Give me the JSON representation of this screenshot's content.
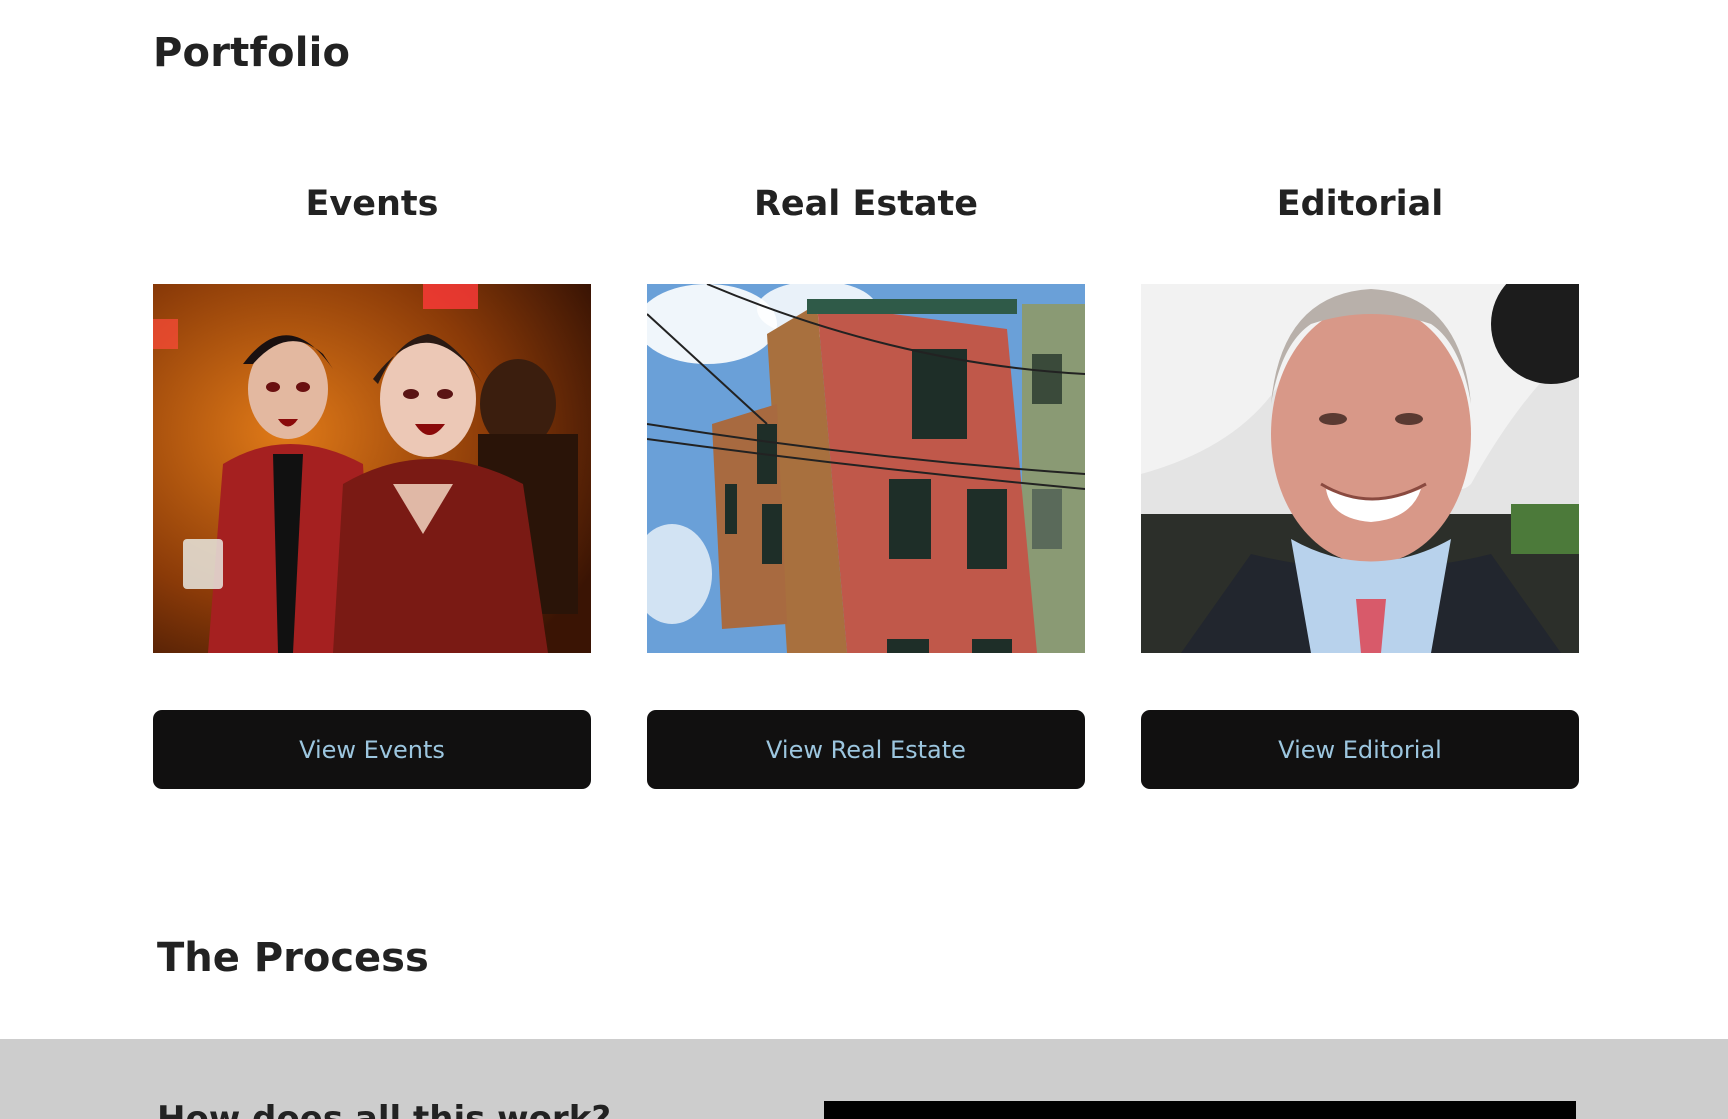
{
  "portfolio": {
    "title": "Portfolio",
    "cards": [
      {
        "title": "Events",
        "button_label": "View Events",
        "image_alt": "event-photo"
      },
      {
        "title": "Real Estate",
        "button_label": "View Real Estate",
        "image_alt": "real-estate-photo"
      },
      {
        "title": "Editorial",
        "button_label": "View Editorial",
        "image_alt": "editorial-photo"
      }
    ]
  },
  "process": {
    "title": "The Process",
    "subheading": "How does all this work?"
  },
  "colors": {
    "button_bg": "#111010",
    "button_text": "#9cc6df",
    "band_bg": "#cdcdcd"
  }
}
